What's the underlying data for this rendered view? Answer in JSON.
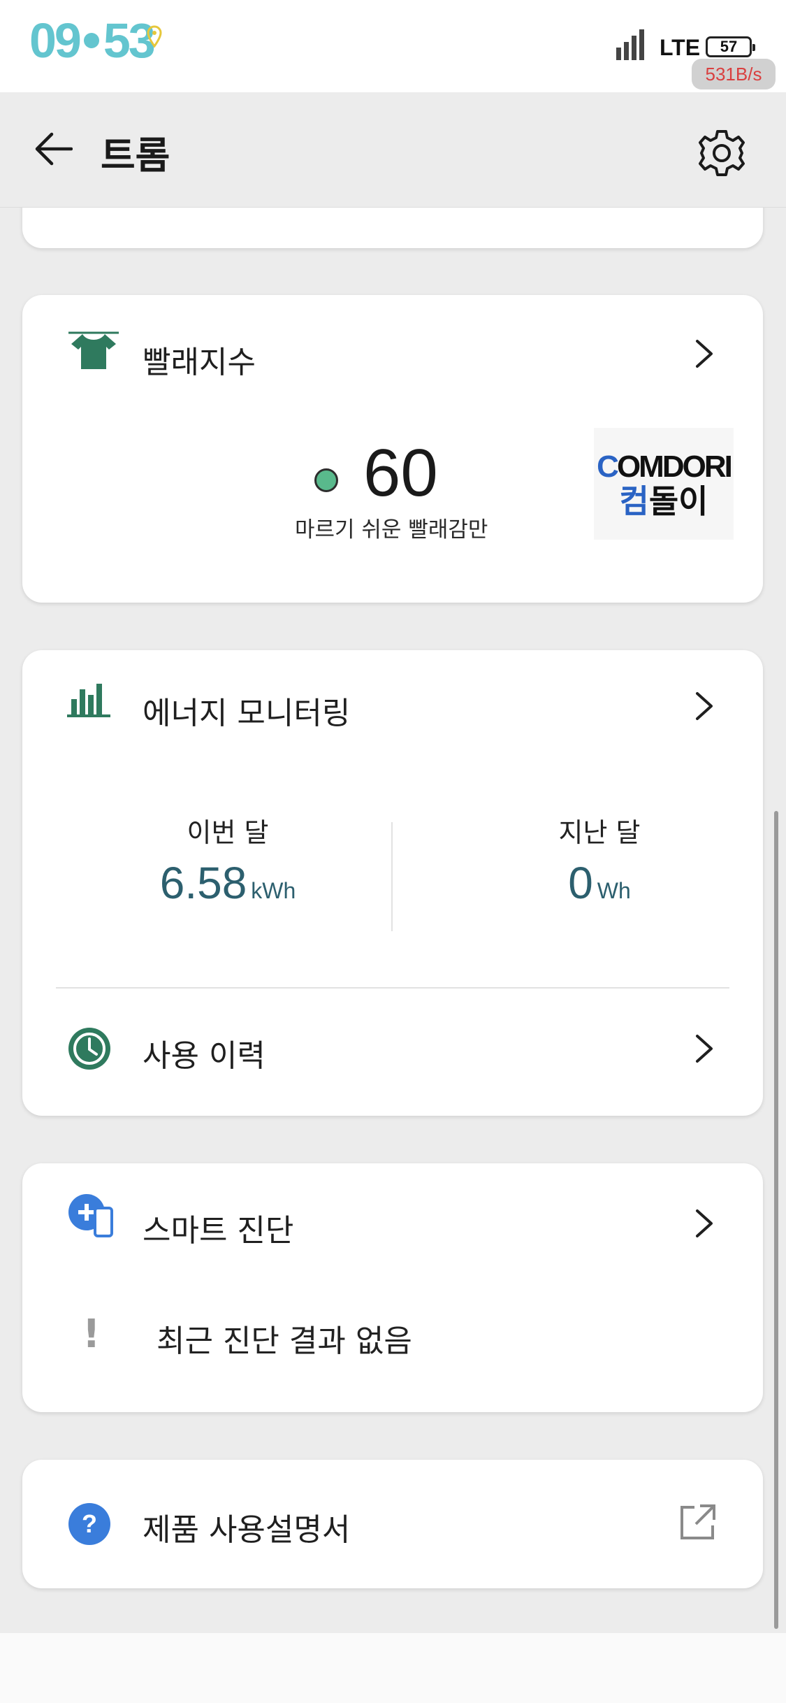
{
  "status_bar": {
    "time_hour": "09",
    "time_minute": "53",
    "network": "LTE",
    "battery": "57",
    "net_speed": "531B/s"
  },
  "app_bar": {
    "title": "트롬",
    "back_icon": "arrow-left-icon",
    "settings_icon": "gear-icon"
  },
  "laundry_card": {
    "title": "빨래지수",
    "value": "60",
    "description": "마르기 쉬운 빨래감만",
    "brand_en": "OMDORI",
    "brand_en_first": "C",
    "brand_ko_first": "컴",
    "brand_ko_rest": "돌이",
    "icon": "shirt-icon"
  },
  "energy_card": {
    "title": "에너지 모니터링",
    "icon": "bar-chart-icon",
    "this_month_label": "이번 달",
    "this_month_value": "6.58",
    "this_month_unit": "kWh",
    "last_month_label": "지난 달",
    "last_month_value": "0",
    "last_month_unit": "Wh",
    "history_label": "사용 이력",
    "history_icon": "clock-icon"
  },
  "diagnosis_card": {
    "title": "스마트 진단",
    "icon": "smart-diagnosis-icon",
    "status_text": "최근 진단 결과 없음",
    "status_icon": "exclamation-icon"
  },
  "manual_card": {
    "title": "제품 사용설명서",
    "icon": "help-icon",
    "action_icon": "external-link-icon"
  },
  "colors": {
    "accent_green": "#2f7a5e",
    "accent_blue": "#3a7ddb",
    "value_teal": "#2c5f6e"
  }
}
